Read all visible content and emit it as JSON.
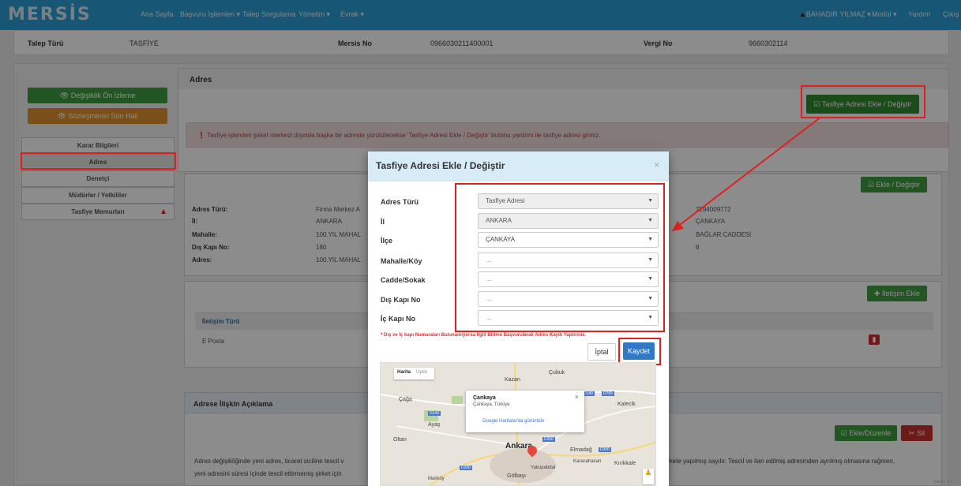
{
  "navbar": {
    "logo": "MERSİS",
    "links": [
      "Ana Sayfa",
      "Başvuru İşlemleri ▾",
      "Talep Sorgulama",
      "Yönetim ▾",
      "Evrak ▾"
    ],
    "user": "BAHADIR YILMAZ ▾",
    "modul": "Modül ▾",
    "help": "Yardım",
    "exit": "Çıkış"
  },
  "info": {
    "talep_turu_label": "Talep Türü",
    "talep_turu_value": "TASFİYE",
    "mersis_no_label": "Mersis No",
    "mersis_no_value": "0966030211400001",
    "vergi_no_label": "Vergi No",
    "vergi_no_value": "9660302114"
  },
  "sidebar": {
    "preview_button": "👁 Değişiklik Ön İzleme",
    "contract_button": "👁 Sözleşmenin Son Hali",
    "items": [
      "Karar Bilgileri",
      "Adres",
      "Denetçi",
      "Müdürler / Yetkililer",
      "Tasfiye Memurları"
    ]
  },
  "address_panel": {
    "title": "Adres",
    "tasfiye_button": "Tasfiye Adresi Ekle / Değiştir",
    "alert": "Tasfiye işlemleri şirket merkezi dışında başka bir adreste yürütülecekse 'Tasfiye Adresi Ekle / Değiştir' butonu yardımı ile tasfiye adresi giriniz.",
    "edit_button": "Ekle / Değiştir",
    "fields": [
      {
        "label": "Adres Türü:",
        "value": "Firma Merkez A"
      },
      {
        "label": "İl:",
        "value": "ANKARA"
      },
      {
        "label": "Mahalle:",
        "value": "100.YIL MAHAL"
      },
      {
        "label": "Dış Kapı No:",
        "value": "180"
      },
      {
        "label": "Adres:",
        "value": "100.YIL MAHAL"
      }
    ],
    "right_values": [
      "7294009772",
      "ÇANKAYA",
      "BAĞLAR CADDESİ",
      "8"
    ]
  },
  "contact_panel": {
    "add_button": "İletişim Ekle",
    "column": "İletişim Türü",
    "row_value": "E Posta"
  },
  "explanation_panel": {
    "title": "Adrese İlişkin Açıklama",
    "edit_button": "Ekle/Düzenle",
    "delete_button": "Sil",
    "text_line1": "Adres değişikliğinde yeni adres, ticaret siciline tescil v",
    "text_line1_right": "rkete yapılmış sayılır. Tescil ve ilan edilmiş adresinden ayrılmış olmasına rağmen,",
    "text_line2": "yeni adresini süresi içinde tescil ettirmemiş şirket için"
  },
  "modal": {
    "title": "Tasfiye Adresi Ekle / Değiştir",
    "close": "×",
    "fields": [
      {
        "label": "Adres Türü",
        "value": "Tasfiye Adresi"
      },
      {
        "label": "İl",
        "value": "ANKARA"
      },
      {
        "label": "İlçe",
        "value": "ÇANKAYA"
      },
      {
        "label": "Mahalle/Köy",
        "value": "..."
      },
      {
        "label": "Cadde/Sokak",
        "value": "..."
      },
      {
        "label": "Dış Kapı No",
        "value": "..."
      },
      {
        "label": "İç Kapı No",
        "value": "..."
      }
    ],
    "warning": "* Dış ve İç kapı Numaraları Bulunamıyorsa İlgili Birime Başvurularak Adres Kaydı Yaptırınız.",
    "cancel_button": "İptal",
    "save_button": "Kaydet"
  },
  "map": {
    "tab_map": "Harita",
    "tab_satellite": "Uydu",
    "popup_title": "Çankaya",
    "popup_subtitle": "Çankaya, Türkiye",
    "popup_link": "Google Haritalar'da görüntüle",
    "places": [
      "Çubuk",
      "Kazan",
      "Çağa",
      "Kalecik",
      "Ayaş",
      "Oltan",
      "Ankara",
      "Elmadağ",
      "Karacahasan",
      "Kırıkkale",
      "Yakupabdal",
      "Gölbaşı",
      "Malıköy"
    ],
    "roads": [
      "D140",
      "D140",
      "D765",
      "D200",
      "D200",
      "D200"
    ]
  },
  "footer_hint": "Sürüm: 8.1"
}
